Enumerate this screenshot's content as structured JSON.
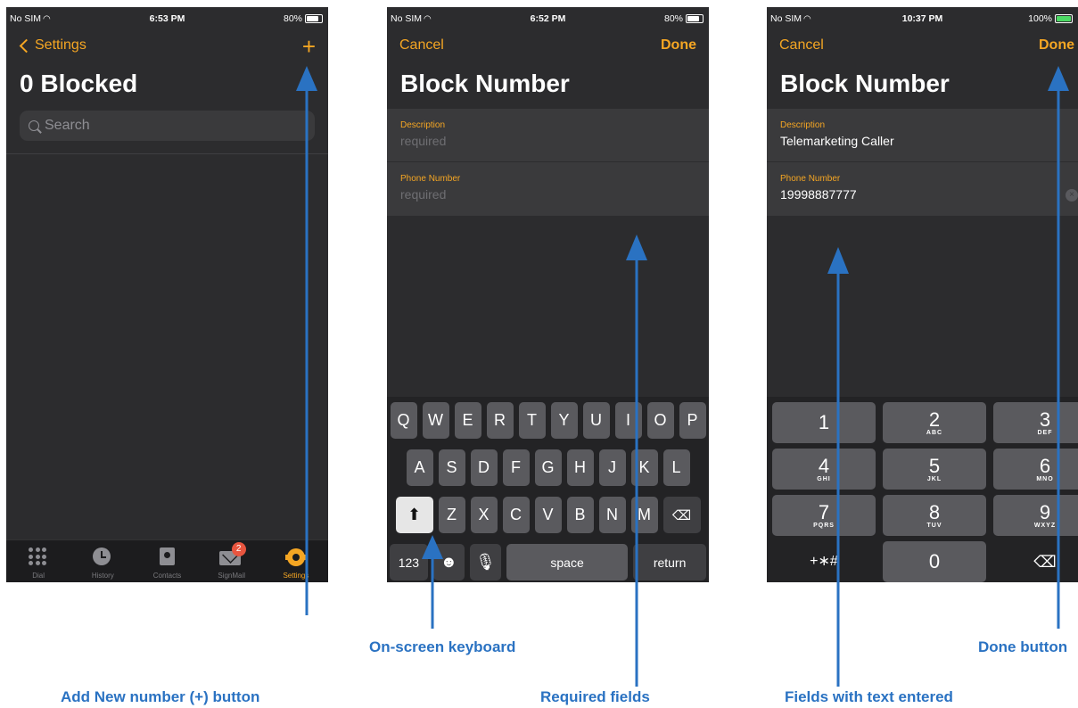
{
  "panel1": {
    "status": {
      "carrier": "No SIM",
      "time": "6:53 PM",
      "battery": "80%"
    },
    "nav": {
      "back_label": "Settings",
      "add_symbol": "+"
    },
    "title": "0 Blocked",
    "search_placeholder": "Search",
    "tabs": [
      {
        "label": "Dial",
        "icon": "keypad-icon"
      },
      {
        "label": "History",
        "icon": "clock-icon"
      },
      {
        "label": "Contacts",
        "icon": "contacts-book-icon"
      },
      {
        "label": "SignMail",
        "icon": "mail-icon",
        "badge": "2"
      },
      {
        "label": "Settings",
        "icon": "gear-icon"
      }
    ]
  },
  "panel2": {
    "status": {
      "carrier": "No SIM",
      "time": "6:52 PM",
      "battery": "80%"
    },
    "nav": {
      "cancel_label": "Cancel",
      "done_label": "Done"
    },
    "title": "Block Number",
    "fields": [
      {
        "label": "Description",
        "placeholder": "required"
      },
      {
        "label": "Phone Number",
        "placeholder": "required"
      }
    ],
    "keyboard": {
      "row1": [
        "Q",
        "W",
        "E",
        "R",
        "T",
        "Y",
        "U",
        "I",
        "O",
        "P"
      ],
      "row2": [
        "A",
        "S",
        "D",
        "F",
        "G",
        "H",
        "J",
        "K",
        "L"
      ],
      "row3": [
        "Z",
        "X",
        "C",
        "V",
        "B",
        "N",
        "M"
      ],
      "numbers_key": "123",
      "space_key": "space",
      "return_key": "return"
    }
  },
  "panel3": {
    "status": {
      "carrier": "No SIM",
      "time": "10:37 PM",
      "battery": "100%"
    },
    "nav": {
      "cancel_label": "Cancel",
      "done_label": "Done"
    },
    "title": "Block Number",
    "fields": [
      {
        "label": "Description",
        "value": "Telemarketing Caller"
      },
      {
        "label": "Phone Number",
        "value": "19998887777"
      }
    ],
    "numpad": [
      {
        "digit": "1",
        "letters": ""
      },
      {
        "digit": "2",
        "letters": "ABC"
      },
      {
        "digit": "3",
        "letters": "DEF"
      },
      {
        "digit": "4",
        "letters": "GHI"
      },
      {
        "digit": "5",
        "letters": "JKL"
      },
      {
        "digit": "6",
        "letters": "MNO"
      },
      {
        "digit": "7",
        "letters": "PQRS"
      },
      {
        "digit": "8",
        "letters": "TUV"
      },
      {
        "digit": "9",
        "letters": "WXYZ"
      },
      {
        "digit": "+∗#",
        "letters": ""
      },
      {
        "digit": "0",
        "letters": ""
      }
    ]
  },
  "annotations": {
    "add_button": "Add New number (+) button",
    "keyboard": "On-screen keyboard",
    "required": "Required fields",
    "entered": "Fields with text entered",
    "done": "Done button"
  },
  "colors": {
    "accent": "#f5a623",
    "annotation": "#2a72c2",
    "background": "#2c2c2e"
  }
}
